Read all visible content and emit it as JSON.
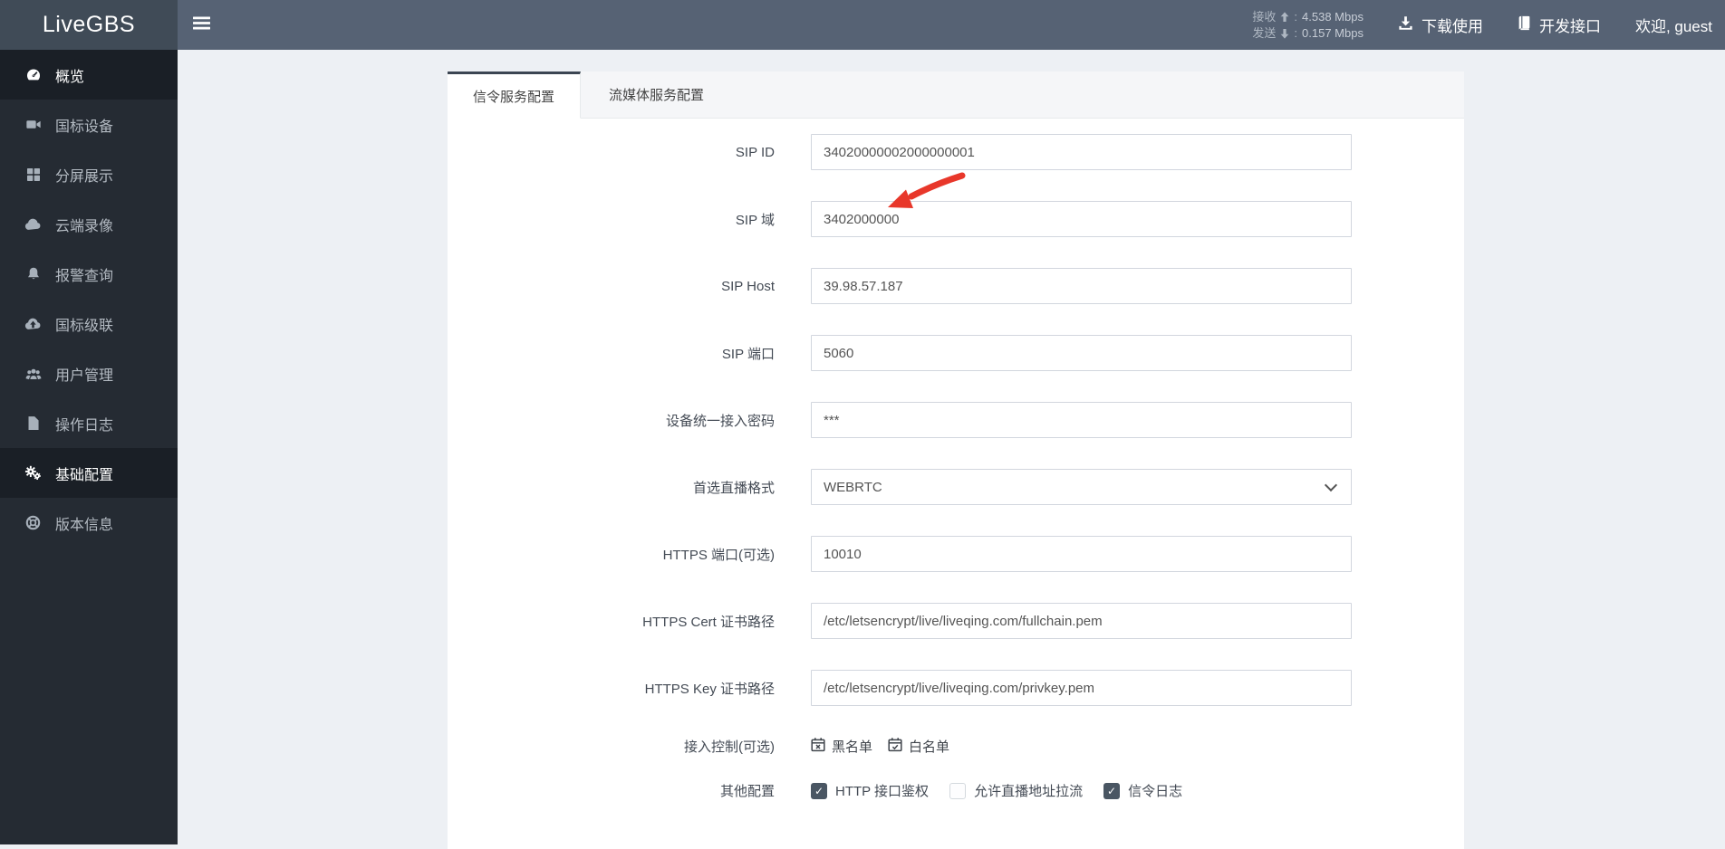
{
  "header": {
    "logo": "LiveGBS",
    "stats": {
      "recv_label": "接收",
      "recv_sep": ":",
      "recv_value": "4.538 Mbps",
      "send_label": "发送",
      "send_sep": ":",
      "send_value": "0.157 Mbps"
    },
    "download_label": "下载使用",
    "api_label": "开发接口",
    "welcome": "欢迎, guest"
  },
  "sidebar": {
    "items": [
      {
        "name": "overview",
        "label": "概览",
        "icon": "dashboard-icon",
        "active": true
      },
      {
        "name": "gb-devices",
        "label": "国标设备",
        "icon": "video-camera-icon",
        "active": false
      },
      {
        "name": "split-screen",
        "label": "分屏展示",
        "icon": "grid-icon",
        "active": false
      },
      {
        "name": "cloud-recording",
        "label": "云端录像",
        "icon": "cloud-icon",
        "active": false
      },
      {
        "name": "alarm-query",
        "label": "报警查询",
        "icon": "bell-icon",
        "active": false
      },
      {
        "name": "gb-cascade",
        "label": "国标级联",
        "icon": "cloud-upload-icon",
        "active": false
      },
      {
        "name": "user-management",
        "label": "用户管理",
        "icon": "users-icon",
        "active": false
      },
      {
        "name": "operation-log",
        "label": "操作日志",
        "icon": "file-icon",
        "active": false
      },
      {
        "name": "basic-config",
        "label": "基础配置",
        "icon": "gears-icon",
        "active": true
      },
      {
        "name": "version-info",
        "label": "版本信息",
        "icon": "life-ring-icon",
        "active": false
      }
    ]
  },
  "tabs": [
    {
      "name": "signal-config",
      "label": "信令服务配置",
      "active": true
    },
    {
      "name": "stream-config",
      "label": "流媒体服务配置",
      "active": false
    }
  ],
  "form": {
    "fields": [
      {
        "name": "sip-id",
        "label": "SIP ID",
        "type": "text",
        "value": "34020000002000000001"
      },
      {
        "name": "sip-domain",
        "label": "SIP 域",
        "type": "text",
        "value": "3402000000"
      },
      {
        "name": "sip-host",
        "label": "SIP Host",
        "type": "text",
        "value": "39.98.57.187"
      },
      {
        "name": "sip-port",
        "label": "SIP 端口",
        "type": "text",
        "value": "5060"
      },
      {
        "name": "device-access-password",
        "label": "设备统一接入密码",
        "type": "text",
        "value": "***"
      },
      {
        "name": "preferred-live-format",
        "label": "首选直播格式",
        "type": "select",
        "value": "WEBRTC"
      },
      {
        "name": "https-port",
        "label": "HTTPS 端口(可选)",
        "type": "text",
        "value": "10010"
      },
      {
        "name": "https-cert-path",
        "label": "HTTPS Cert 证书路径",
        "type": "text",
        "value": "/etc/letsencrypt/live/liveqing.com/fullchain.pem"
      },
      {
        "name": "https-key-path",
        "label": "HTTPS Key 证书路径",
        "type": "text",
        "value": "/etc/letsencrypt/live/liveqing.com/privkey.pem"
      }
    ],
    "access_control": {
      "label": "接入控制(可选)",
      "blacklist": "黑名单",
      "whitelist": "白名单"
    },
    "other": {
      "label": "其他配置",
      "checkboxes": [
        {
          "name": "http-api-auth",
          "label": "HTTP 接口鉴权",
          "checked": true
        },
        {
          "name": "allow-pull-live",
          "label": "允许直播地址拉流",
          "checked": false
        },
        {
          "name": "signal-log",
          "label": "信令日志",
          "checked": true
        }
      ]
    }
  },
  "annotation": {
    "arrow_color": "#e8372a",
    "points_at": "sip-domain-input"
  },
  "colors": {
    "header_bg": "#566274",
    "logo_bg": "#404b57",
    "sidebar_bg": "#252b33",
    "sidebar_active_bg": "#1a1f26",
    "body_bg": "#edf0f4",
    "tab_top_border": "#3b4552",
    "input_border": "#d2d6de",
    "checkbox_checked": "#4a5663"
  }
}
